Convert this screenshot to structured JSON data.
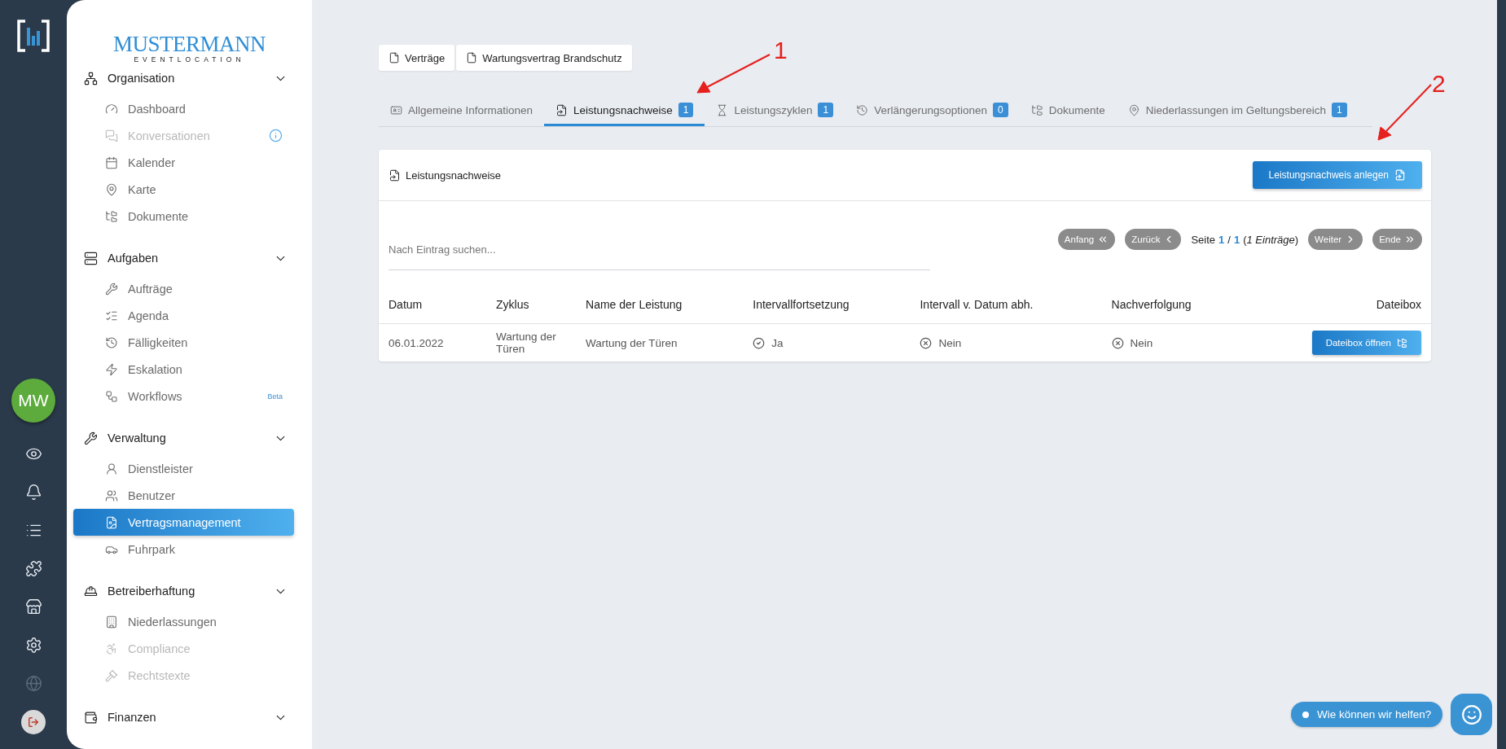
{
  "rail": {
    "avatar": "MW"
  },
  "logo": {
    "title": "MUSTERMANN",
    "subtitle": "EVENTLOCATION"
  },
  "sidebar": {
    "sections": [
      {
        "label": "Organisation",
        "expanded": true,
        "items": [
          {
            "label": "Dashboard",
            "disabled": false,
            "selected": false
          },
          {
            "label": "Konversationen",
            "disabled": true,
            "selected": false,
            "alert": true
          },
          {
            "label": "Kalender",
            "disabled": false,
            "selected": false
          },
          {
            "label": "Karte",
            "disabled": false,
            "selected": false
          },
          {
            "label": "Dokumente",
            "disabled": false,
            "selected": false
          }
        ]
      },
      {
        "label": "Aufgaben",
        "expanded": true,
        "items": [
          {
            "label": "Aufträge",
            "disabled": false,
            "selected": false
          },
          {
            "label": "Agenda",
            "disabled": false,
            "selected": false
          },
          {
            "label": "Fälligkeiten",
            "disabled": false,
            "selected": false
          },
          {
            "label": "Eskalation",
            "disabled": false,
            "selected": false
          },
          {
            "label": "Workflows",
            "disabled": false,
            "selected": false,
            "tag": "Beta"
          }
        ]
      },
      {
        "label": "Verwaltung",
        "expanded": true,
        "items": [
          {
            "label": "Dienstleister",
            "disabled": false,
            "selected": false
          },
          {
            "label": "Benutzer",
            "disabled": false,
            "selected": false
          },
          {
            "label": "Vertragsmanagement",
            "disabled": false,
            "selected": true
          },
          {
            "label": "Fuhrpark",
            "disabled": false,
            "selected": false
          }
        ]
      },
      {
        "label": "Betreiberhaftung",
        "expanded": true,
        "items": [
          {
            "label": "Niederlassungen",
            "disabled": false,
            "selected": false
          },
          {
            "label": "Compliance",
            "disabled": true,
            "selected": false
          },
          {
            "label": "Rechtstexte",
            "disabled": true,
            "selected": false
          }
        ]
      },
      {
        "label": "Finanzen",
        "expanded": true
      }
    ]
  },
  "breadcrumb": [
    "Verträge",
    "Wartungsvertrag Brandschutz"
  ],
  "tabs": [
    {
      "label": "Allgemeine Informationen",
      "selected": false
    },
    {
      "label": "Leistungsnachweise",
      "count": "1",
      "selected": true
    },
    {
      "label": "Leistungszyklen",
      "count": "1",
      "selected": false
    },
    {
      "label": "Verlängerungsoptionen",
      "count": "0",
      "selected": false
    },
    {
      "label": "Dokumente",
      "selected": false
    },
    {
      "label": "Niederlassungen im Geltungsbereich",
      "count": "1",
      "selected": false
    }
  ],
  "card": {
    "title": "Leistungsnachweise",
    "add_button": "Leistungsnachweis anlegen",
    "search": {
      "placeholder": "Nach Eintrag suchen..."
    },
    "pagination": {
      "first": "Anfang",
      "prev": "Zurück",
      "next": "Weiter",
      "last": "Ende",
      "prefix": "Seite",
      "current": "1",
      "separator": "/",
      "total": "1",
      "entries": "(*1 Einträge*)"
    },
    "table": {
      "columns": [
        "Datum",
        "Zyklus",
        "Name der Leistung",
        "Intervallfortsetzung",
        "Intervall v. Datum abh.",
        "Nachverfolgung",
        "Dateibox"
      ],
      "rows": [
        {
          "cells": [
            {
              "text": "06.01.2022"
            },
            {
              "text": "Wartung der Türen"
            },
            {
              "text": "Wartung der Türen"
            },
            {
              "text": "Ja",
              "kind": "yes"
            },
            {
              "text": "Nein",
              "kind": "no"
            },
            {
              "text": "Nein",
              "kind": "no"
            }
          ],
          "action": "Dateibox öffnen"
        }
      ]
    }
  },
  "chat": {
    "label": "Wie können wir helfen?"
  },
  "annotations": [
    "1",
    "2"
  ]
}
